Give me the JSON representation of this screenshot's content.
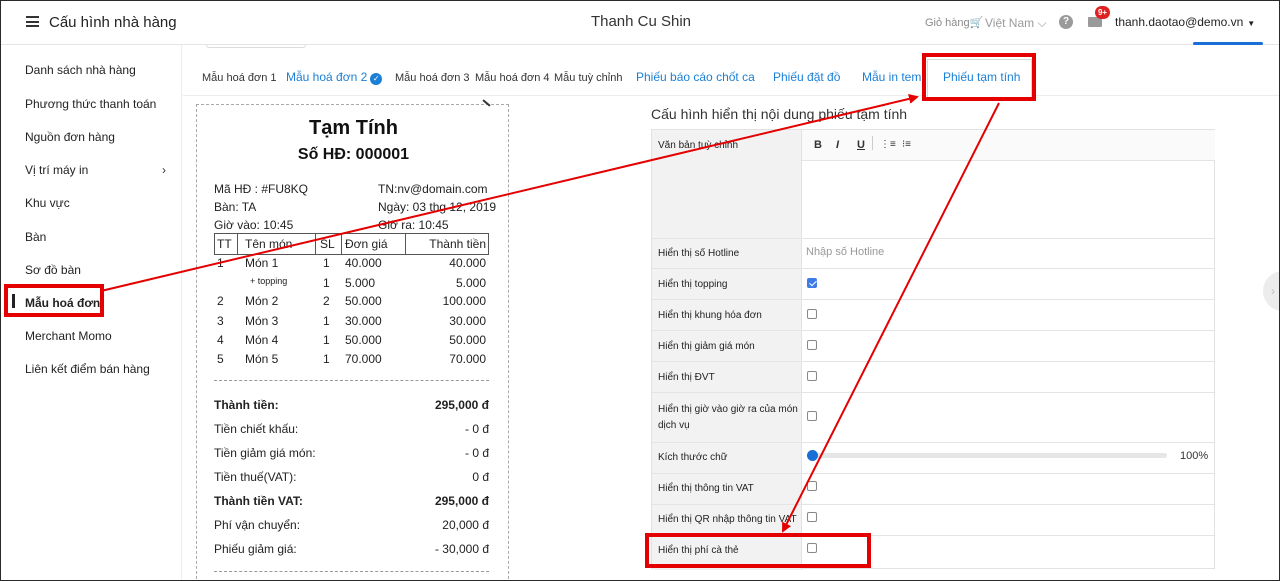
{
  "header": {
    "app_title": "Cấu hình nhà hàng",
    "shop_name": "Thanh Cu Shin",
    "cart_label": "Giỏ hàng",
    "language": "Việt Nam",
    "notification_count": "9+",
    "user_email": "thanh.daotao@demo.vn"
  },
  "sidebar": {
    "items": [
      {
        "label": "Danh sách nhà hàng"
      },
      {
        "label": "Phương thức thanh toán"
      },
      {
        "label": "Nguồn đơn hàng"
      },
      {
        "label": "Vị trí máy in"
      },
      {
        "label": "Khu vực"
      },
      {
        "label": "Bàn"
      },
      {
        "label": "Sơ đồ bàn"
      },
      {
        "label": "Mẫu hoá đơn"
      },
      {
        "label": "Merchant Momo"
      },
      {
        "label": "Liên kết điểm bán hàng"
      }
    ],
    "active": "Mẫu hoá đơn"
  },
  "tabs": [
    {
      "label": "Mẫu hoá đơn 1"
    },
    {
      "label": "Mẫu hoá đơn 2"
    },
    {
      "label": "Mẫu hoá đơn 3"
    },
    {
      "label": "Mẫu hoá đơn 4"
    },
    {
      "label": "Mẫu tuỳ chỉnh"
    },
    {
      "label": "Phiếu báo cáo chốt ca"
    },
    {
      "label": "Phiếu đặt đồ"
    },
    {
      "label": "Mẫu in tem"
    },
    {
      "label": "Phiếu tạm tính"
    }
  ],
  "active_tab": "Phiếu tạm tính",
  "receipt": {
    "title": "Tạm Tính",
    "invoice_no": "Số HĐ: 000001",
    "order_code": "Mã HĐ : #FU8KQ",
    "staff": "TN:nv@domain.com",
    "table": "Bàn: TA",
    "date": "Ngày: 03 thg 12, 2019",
    "time_in": "Giờ vào: 10:45",
    "time_out": "Giờ ra: 10:45",
    "columns": [
      "TT",
      "Tên món",
      "SL",
      "Đơn giá",
      "Thành tiền"
    ],
    "rows": [
      {
        "no": "1",
        "name": "Món 1",
        "qty": "1",
        "price": "40.000",
        "total": "40.000"
      },
      {
        "no": "",
        "name": "+ topping",
        "qty": "1",
        "price": "5.000",
        "total": "5.000"
      },
      {
        "no": "2",
        "name": "Món 2",
        "qty": "2",
        "price": "50.000",
        "total": "100.000"
      },
      {
        "no": "3",
        "name": "Món 3",
        "qty": "1",
        "price": "30.000",
        "total": "30.000"
      },
      {
        "no": "4",
        "name": "Món 4",
        "qty": "1",
        "price": "50.000",
        "total": "50.000"
      },
      {
        "no": "5",
        "name": "Món 5",
        "qty": "1",
        "price": "70.000",
        "total": "70.000"
      }
    ],
    "summary": [
      {
        "label": "Thành tiền:",
        "value": "295,000 đ",
        "bold": true
      },
      {
        "label": "Tiền chiết khấu:",
        "value": "- 0 đ",
        "bold": false
      },
      {
        "label": "Tiền giảm giá món:",
        "value": "- 0 đ",
        "bold": false
      },
      {
        "label": "Tiền thuế(VAT):",
        "value": "0 đ",
        "bold": false
      },
      {
        "label": "Thành tiền VAT:",
        "value": "295,000 đ",
        "bold": true
      },
      {
        "label": "Phí vận chuyển:",
        "value": "20,000 đ",
        "bold": false
      },
      {
        "label": "Phiếu giảm giá:",
        "value": "- 30,000 đ",
        "bold": false
      }
    ]
  },
  "config": {
    "title": "Cấu hình hiển thị nội dung phiếu tạm tính",
    "custom_text_label": "Văn bản tuỳ chỉnh",
    "toolbar": {
      "bold": "B",
      "italic": "I",
      "underline": "U"
    },
    "hotline_label": "Hiển thị số Hotline",
    "hotline_placeholder": "Nhập số Hotline",
    "options": [
      {
        "label": "Hiển thị topping",
        "checked": true
      },
      {
        "label": "Hiển thị khung hóa đơn",
        "checked": false
      },
      {
        "label": "Hiển thị giảm giá món",
        "checked": false
      },
      {
        "label": "Hiển thị ĐVT",
        "checked": false
      },
      {
        "label": "Hiển thị giờ vào giờ ra của món dịch vụ",
        "checked": false
      }
    ],
    "font_size_label": "Kích thước chữ",
    "font_size_value": "100%",
    "font_size_percent": 100,
    "options2": [
      {
        "label": "Hiển thị thông tin VAT",
        "checked": false
      },
      {
        "label": "Hiển thị QR nhập thông tin VAT",
        "checked": false
      },
      {
        "label": "Hiển thị phí cà thẻ",
        "checked": false
      }
    ]
  },
  "colors": {
    "accent": "#1a7fd6",
    "highlight": "#e40000",
    "checkbox_on": "#3d7be8"
  }
}
